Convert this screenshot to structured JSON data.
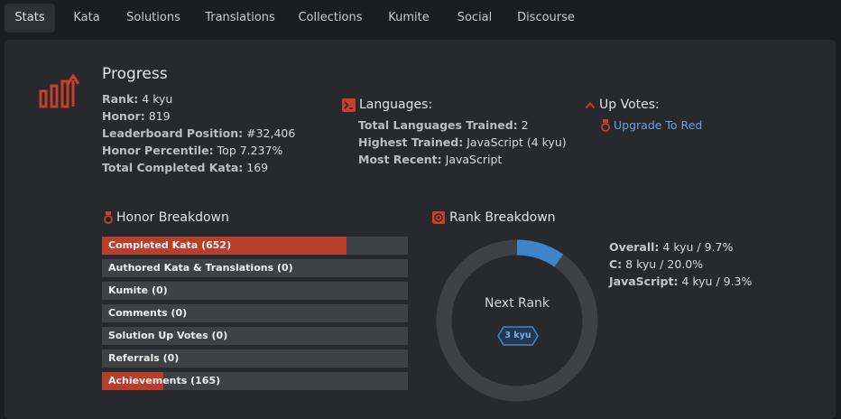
{
  "tabs": [
    {
      "label": "Stats",
      "active": true
    },
    {
      "label": "Kata"
    },
    {
      "label": "Solutions"
    },
    {
      "label": "Translations"
    },
    {
      "label": "Collections"
    },
    {
      "label": "Kumite"
    },
    {
      "label": "Social"
    },
    {
      "label": "Discourse"
    }
  ],
  "progress": {
    "title": "Progress",
    "rows": [
      {
        "k": "Rank:",
        "v": "4 kyu"
      },
      {
        "k": "Honor:",
        "v": "819"
      },
      {
        "k": "Leaderboard Position:",
        "v": "#32,406"
      },
      {
        "k": "Honor Percentile:",
        "v": "Top 7.237%"
      },
      {
        "k": "Total Completed Kata:",
        "v": "169"
      }
    ]
  },
  "languages": {
    "title": "Languages:",
    "rows": [
      {
        "k": "Total Languages Trained:",
        "v": "2"
      },
      {
        "k": "Highest Trained:",
        "v": "JavaScript (4 kyu)"
      },
      {
        "k": "Most Recent:",
        "v": "JavaScript"
      }
    ]
  },
  "upvotes": {
    "title": "Up Votes:",
    "link": "Upgrade To Red"
  },
  "honor_breakdown": {
    "title": "Honor Breakdown",
    "items": [
      {
        "label": "Completed Kata (652)",
        "fill": 0.8
      },
      {
        "label": "Authored Kata & Translations (0)",
        "fill": 0
      },
      {
        "label": "Kumite (0)",
        "fill": 0
      },
      {
        "label": "Comments (0)",
        "fill": 0
      },
      {
        "label": "Solution Up Votes (0)",
        "fill": 0
      },
      {
        "label": "Referrals (0)",
        "fill": 0
      },
      {
        "label": "Achievements (165)",
        "fill": 0.2
      }
    ]
  },
  "rank_breakdown": {
    "title": "Rank Breakdown",
    "center_label": "Next Rank",
    "badge": "3 kyu",
    "progress_fraction": 0.097,
    "rows": [
      {
        "k": "Overall:",
        "v": "4 kyu / 9.7%"
      },
      {
        "k": "C:",
        "v": "8 kyu / 20.0%"
      },
      {
        "k": "JavaScript:",
        "v": "4 kyu / 9.3%"
      }
    ]
  },
  "colors": {
    "accent_red": "#b63e2b",
    "ring_blue": "#3f84c8",
    "ring_track": "#404144",
    "link_blue": "#6f9fdc"
  }
}
